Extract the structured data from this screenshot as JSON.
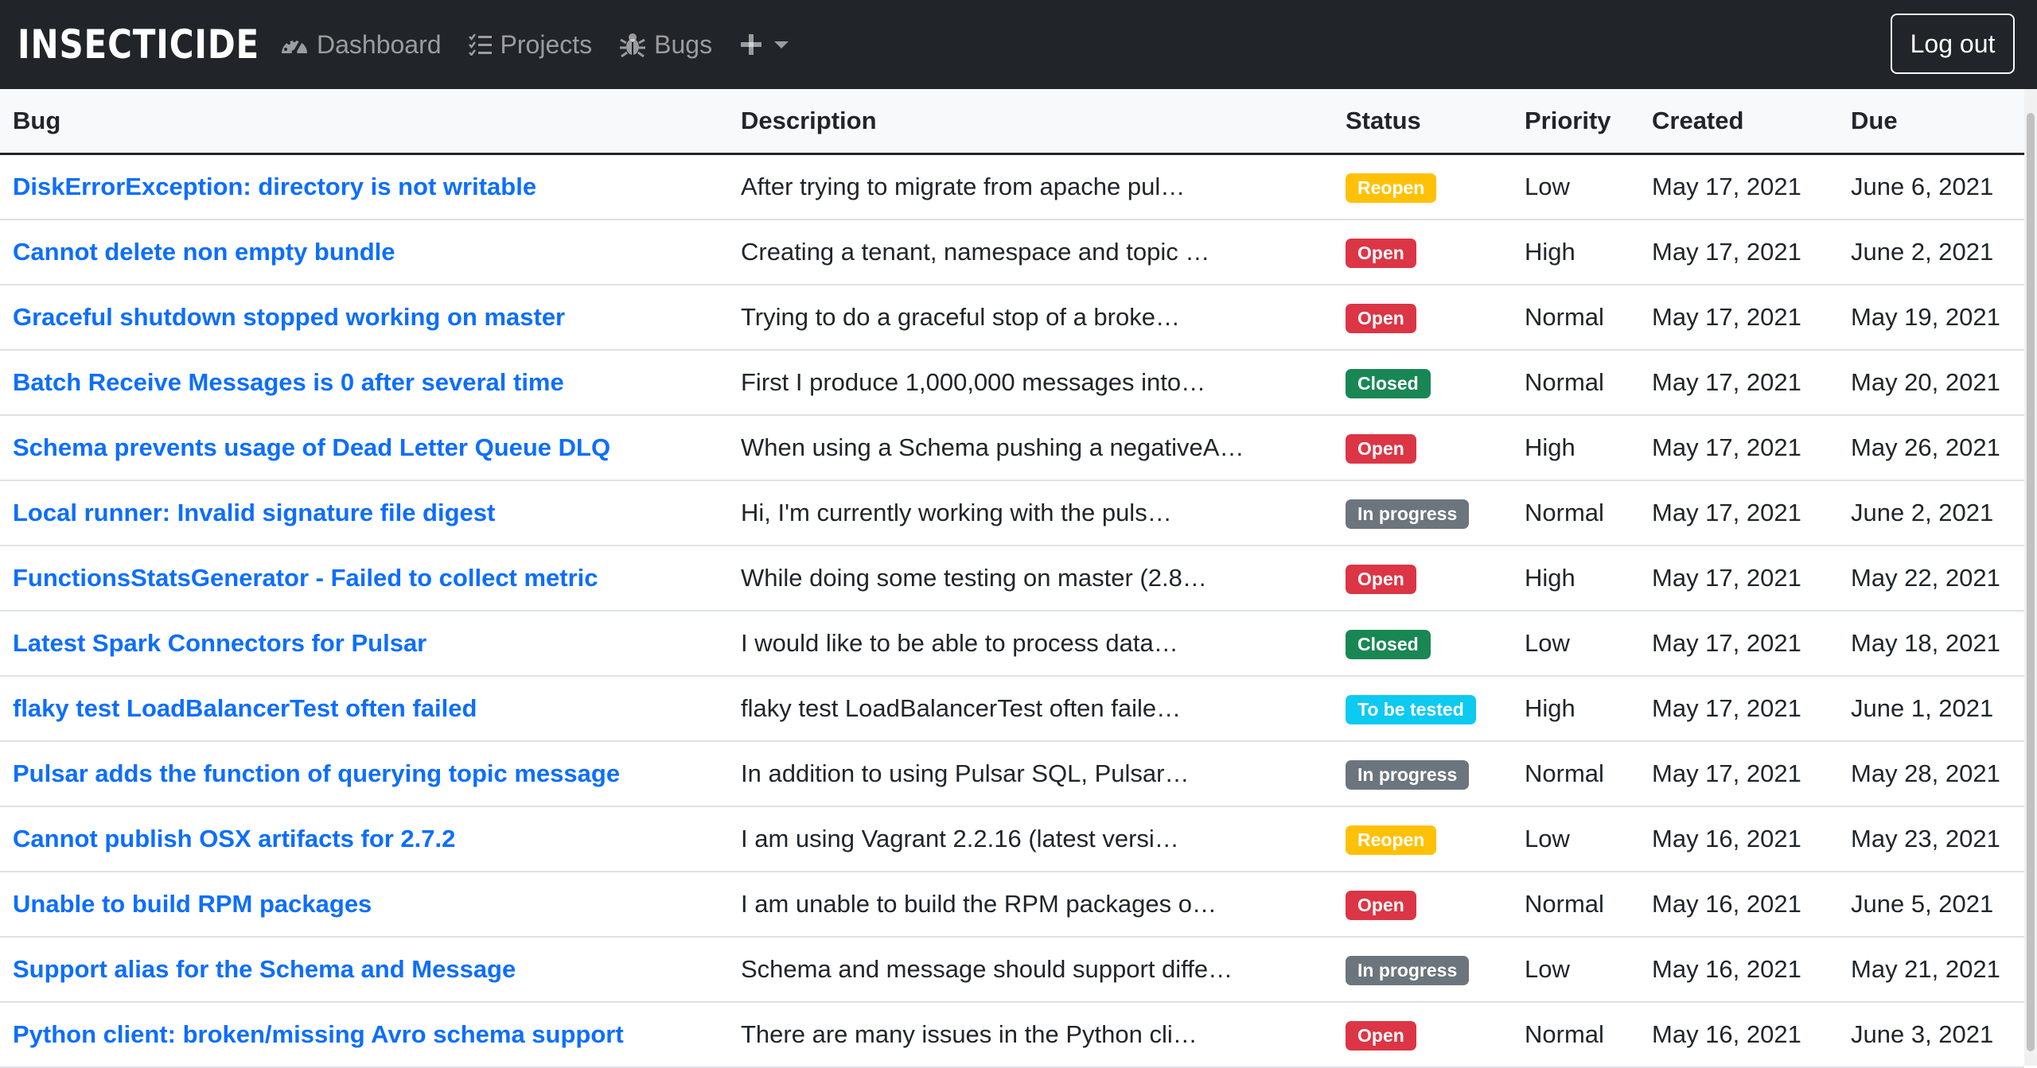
{
  "nav": {
    "brand": "INSECTICIDE",
    "items": [
      {
        "label": "Dashboard",
        "icon": "dashboard-icon"
      },
      {
        "label": "Projects",
        "icon": "list-icon"
      },
      {
        "label": "Bugs",
        "icon": "bug-icon"
      }
    ],
    "add_icon": "plus-icon",
    "logout_label": "Log out"
  },
  "table": {
    "headers": {
      "bug": "Bug",
      "description": "Description",
      "status": "Status",
      "priority": "Priority",
      "created": "Created",
      "due": "Due"
    },
    "status_colors": {
      "Reopen": {
        "bg": "#ffc107",
        "fg": "#ffffff"
      },
      "Open": {
        "bg": "#dc3545",
        "fg": "#ffffff"
      },
      "Closed": {
        "bg": "#198754",
        "fg": "#ffffff"
      },
      "In progress": {
        "bg": "#6c757d",
        "fg": "#ffffff"
      },
      "To be tested": {
        "bg": "#0dcaf0",
        "fg": "#ffffff"
      }
    },
    "rows": [
      {
        "bug": "DiskErrorException: directory is not writable",
        "description": "After trying to migrate from apache pul…",
        "status": "Reopen",
        "priority": "Low",
        "created": "May 17, 2021",
        "due": "June 6, 2021"
      },
      {
        "bug": "Cannot delete non empty bundle",
        "description": "Creating a tenant, namespace and topic …",
        "status": "Open",
        "priority": "High",
        "created": "May 17, 2021",
        "due": "June 2, 2021"
      },
      {
        "bug": "Graceful shutdown stopped working on master",
        "description": "Trying to do a graceful stop of a broke…",
        "status": "Open",
        "priority": "Normal",
        "created": "May 17, 2021",
        "due": "May 19, 2021"
      },
      {
        "bug": "Batch Receive Messages is 0 after several time",
        "description": "First I produce 1,000,000 messages into…",
        "status": "Closed",
        "priority": "Normal",
        "created": "May 17, 2021",
        "due": "May 20, 2021"
      },
      {
        "bug": "Schema prevents usage of Dead Letter Queue DLQ",
        "description": "When using a Schema pushing a negativeA…",
        "status": "Open",
        "priority": "High",
        "created": "May 17, 2021",
        "due": "May 26, 2021"
      },
      {
        "bug": "Local runner: Invalid signature file digest",
        "description": "Hi, I'm currently working with the puls…",
        "status": "In progress",
        "priority": "Normal",
        "created": "May 17, 2021",
        "due": "June 2, 2021"
      },
      {
        "bug": "FunctionsStatsGenerator - Failed to collect metric",
        "description": "While doing some testing on master (2.8…",
        "status": "Open",
        "priority": "High",
        "created": "May 17, 2021",
        "due": "May 22, 2021"
      },
      {
        "bug": "Latest Spark Connectors for Pulsar",
        "description": "I would like to be able to process data…",
        "status": "Closed",
        "priority": "Low",
        "created": "May 17, 2021",
        "due": "May 18, 2021"
      },
      {
        "bug": "flaky test LoadBalancerTest often failed",
        "description": "flaky test LoadBalancerTest often faile…",
        "status": "To be tested",
        "priority": "High",
        "created": "May 17, 2021",
        "due": "June 1, 2021"
      },
      {
        "bug": "Pulsar adds the function of querying topic message",
        "description": "In addition to using Pulsar SQL, Pulsar…",
        "status": "In progress",
        "priority": "Normal",
        "created": "May 17, 2021",
        "due": "May 28, 2021"
      },
      {
        "bug": "Cannot publish OSX artifacts for 2.7.2",
        "description": "I am using Vagrant 2.2.16 (latest versi…",
        "status": "Reopen",
        "priority": "Low",
        "created": "May 16, 2021",
        "due": "May 23, 2021"
      },
      {
        "bug": "Unable to build RPM packages",
        "description": "I am unable to build the RPM packages o…",
        "status": "Open",
        "priority": "Normal",
        "created": "May 16, 2021",
        "due": "June 5, 2021"
      },
      {
        "bug": "Support alias for the Schema and Message",
        "description": "Schema and message should support diffe…",
        "status": "In progress",
        "priority": "Low",
        "created": "May 16, 2021",
        "due": "May 21, 2021"
      },
      {
        "bug": "Python client: broken/missing Avro schema support",
        "description": "There are many issues in the Python cli…",
        "status": "Open",
        "priority": "Normal",
        "created": "May 16, 2021",
        "due": "June 3, 2021"
      }
    ]
  }
}
